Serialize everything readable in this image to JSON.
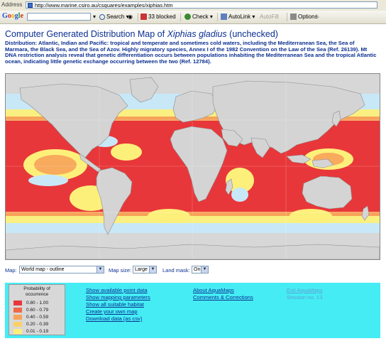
{
  "browser": {
    "address_label": "Address",
    "url": "http://www.marine.csiro.au/csquares/examples/xiphias.htm",
    "toolbar": {
      "logo": [
        "G",
        "o",
        "o",
        "g",
        "l",
        "e"
      ],
      "search_label": "Search",
      "blocked_label": "33 blocked",
      "check_label": "Check",
      "autolink_label": "AutoLink",
      "autofill_label": "AutoFill",
      "options_label": "Options"
    }
  },
  "page": {
    "title_prefix": "Computer Generated Distribution Map of ",
    "title_species": "Xiphias gladius",
    "title_suffix": " (unchecked)",
    "distribution": "Distribution: Atlantic, Indian and Pacific: tropical and temperate and sometimes cold waters, including the Mediterranean Sea, the Sea of Marmara, the Black Sea, and the Sea of Azov. Highly migratory species, Annex I of the 1982 Convention on the Law of the Sea (Ref. 26139). Mt DNA restriction analysis reveal that genetic differentiation occurs between populations inhabiting the Mediterranean Sea and the tropical Atlantic ocean, indicating little genetic exchange occurring between the two (Ref. 12784)."
  },
  "controls": {
    "map_label": "Map:",
    "map_value": "World map - outline",
    "size_label": "Map size:",
    "size_value": "Large",
    "mask_label": "Land mask:",
    "mask_value": "On"
  },
  "legend": {
    "title_line1": "Probability of",
    "title_line2": "occurrence",
    "items": [
      {
        "label": "0.80 - 1.00",
        "color": "#e8373a"
      },
      {
        "label": "0.60 - 0.79",
        "color": "#f06848"
      },
      {
        "label": "0.40 - 0.59",
        "color": "#f7a25a"
      },
      {
        "label": "0.20 - 0.39",
        "color": "#fbd06a"
      },
      {
        "label": "0.01 - 0.19",
        "color": "#fdf07a"
      }
    ]
  },
  "links": {
    "point_data": "Show available point data",
    "mapping_params": "Show mapping parameters",
    "suitable_habitat": "Show all suitable habitat",
    "create_map": "Create your own map",
    "download": "Download data (as csv)",
    "about": "About AquaMaps",
    "comments": "Comments & Corrections",
    "exit": "Exit AquaMaps",
    "session": "Session no. 13"
  },
  "colors": {
    "ocean_background": "#c8e8f8",
    "land": "#d4d4d4",
    "panel": "#45ecf4",
    "title": "#0b2f91"
  }
}
